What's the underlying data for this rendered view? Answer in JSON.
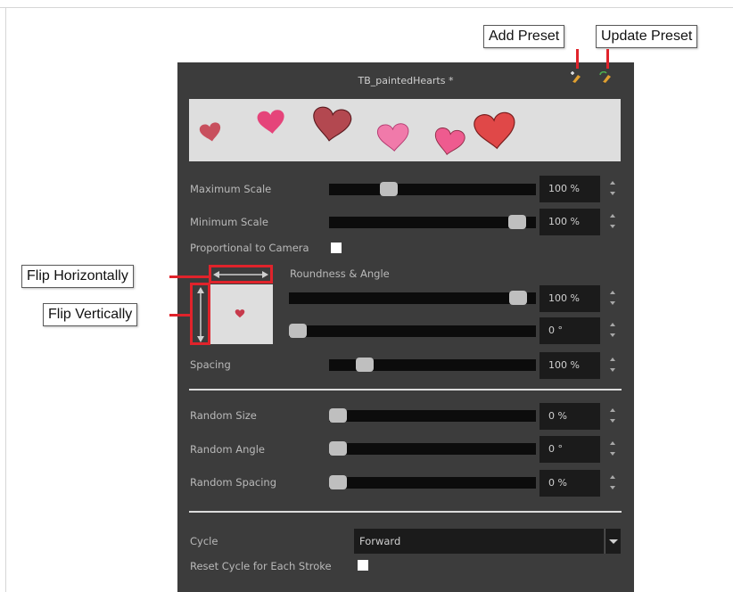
{
  "callouts": {
    "add_preset": "Add Preset",
    "update_preset": "Update Preset",
    "flip_horizontally": "Flip Horizontally",
    "flip_vertically": "Flip Vertically"
  },
  "panel": {
    "title": "TB_paintedHearts *",
    "add_preset_icon": "add-preset-icon",
    "update_preset_icon": "update-preset-icon"
  },
  "scale": {
    "maximum_label": "Maximum Scale",
    "maximum_value": "100 %",
    "maximum_level": 0.27,
    "minimum_label": "Minimum Scale",
    "minimum_value": "100 %",
    "minimum_level": 0.95
  },
  "proportional": {
    "label": "Proportional to Camera",
    "checked": false
  },
  "roundness": {
    "label": "Roundness & Angle",
    "roundness_value": "100 %",
    "roundness_level": 0.96,
    "angle_value": "0 °",
    "angle_level": 0.0
  },
  "spacing": {
    "label": "Spacing",
    "value": "100 %",
    "level": 0.14
  },
  "random": {
    "size_label": "Random Size",
    "size_value": "0 %",
    "size_level": 0.0,
    "angle_label": "Random Angle",
    "angle_value": "0 °",
    "angle_level": 0.0,
    "spacing_label": "Random Spacing",
    "spacing_value": "0 %",
    "spacing_level": 0.0
  },
  "cycle": {
    "label": "Cycle",
    "value": "Forward"
  },
  "reset_cycle": {
    "label": "Reset Cycle for Each Stroke",
    "checked": false
  },
  "colors": {
    "accent_red": "#e0232b",
    "panel_bg": "#3c3c3c",
    "heart": "#c73a4c"
  }
}
